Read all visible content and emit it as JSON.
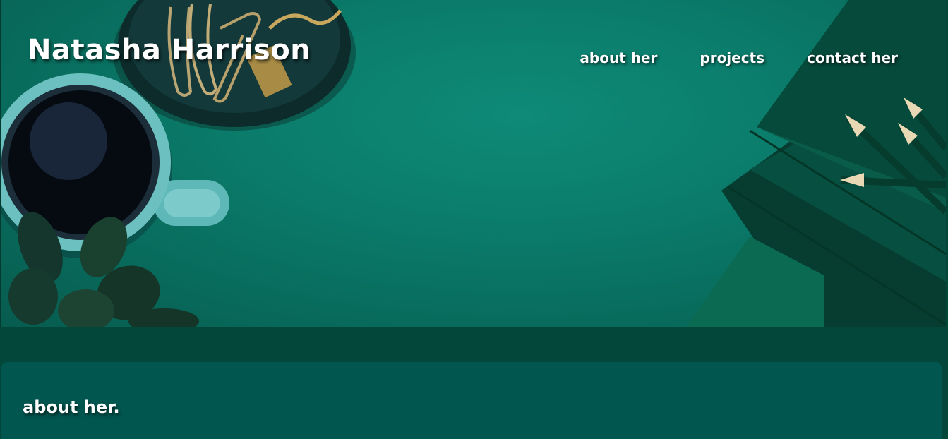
{
  "header": {
    "site_title": "Natasha Harrison"
  },
  "nav": {
    "items": [
      "about her",
      "projects",
      "contact her"
    ]
  },
  "hero": {
    "image": "desk-flatlay-photo"
  },
  "about": {
    "heading": "about her."
  },
  "colors": {
    "hero_bg": "#0b7d6c",
    "page_bg": "#02473a",
    "card_bg": "#025650",
    "text": "#ffffff"
  }
}
